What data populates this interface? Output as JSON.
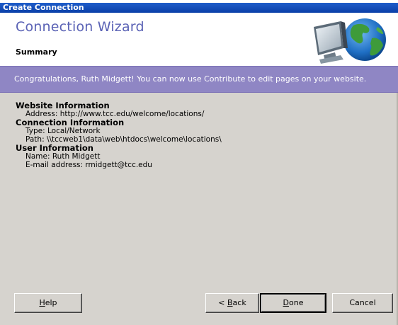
{
  "window": {
    "title": "Create Connection"
  },
  "header": {
    "title": "Connection Wizard",
    "subtitle": "Summary",
    "logo_icon": "computer-globe-icon"
  },
  "banner": {
    "message": "Congratulations, Ruth Midgett! You can now use Contribute to edit pages on your website."
  },
  "summary": {
    "website_heading": "Website Information",
    "address": "Address: http://www.tcc.edu/welcome/locations/",
    "connection_heading": "Connection Information",
    "type": "Type: Local/Network",
    "path": "Path: \\\\tccweb1\\data\\web\\htdocs\\welcome\\locations\\",
    "user_heading": "User Information",
    "name": "Name: Ruth Midgett",
    "email": "E-mail address: rmidgett@tcc.edu"
  },
  "buttons": {
    "help_mnemonic": "H",
    "help_rest": "elp",
    "back_prefix": "< ",
    "back_mnemonic": "B",
    "back_rest": "ack",
    "done_mnemonic": "D",
    "done_rest": "one",
    "cancel": "Cancel"
  },
  "colors": {
    "title_bar": "#0a3fa8",
    "wizard_title": "#5a62b5",
    "banner": "#8f86c4",
    "dialog_face": "#d6d3ce"
  }
}
